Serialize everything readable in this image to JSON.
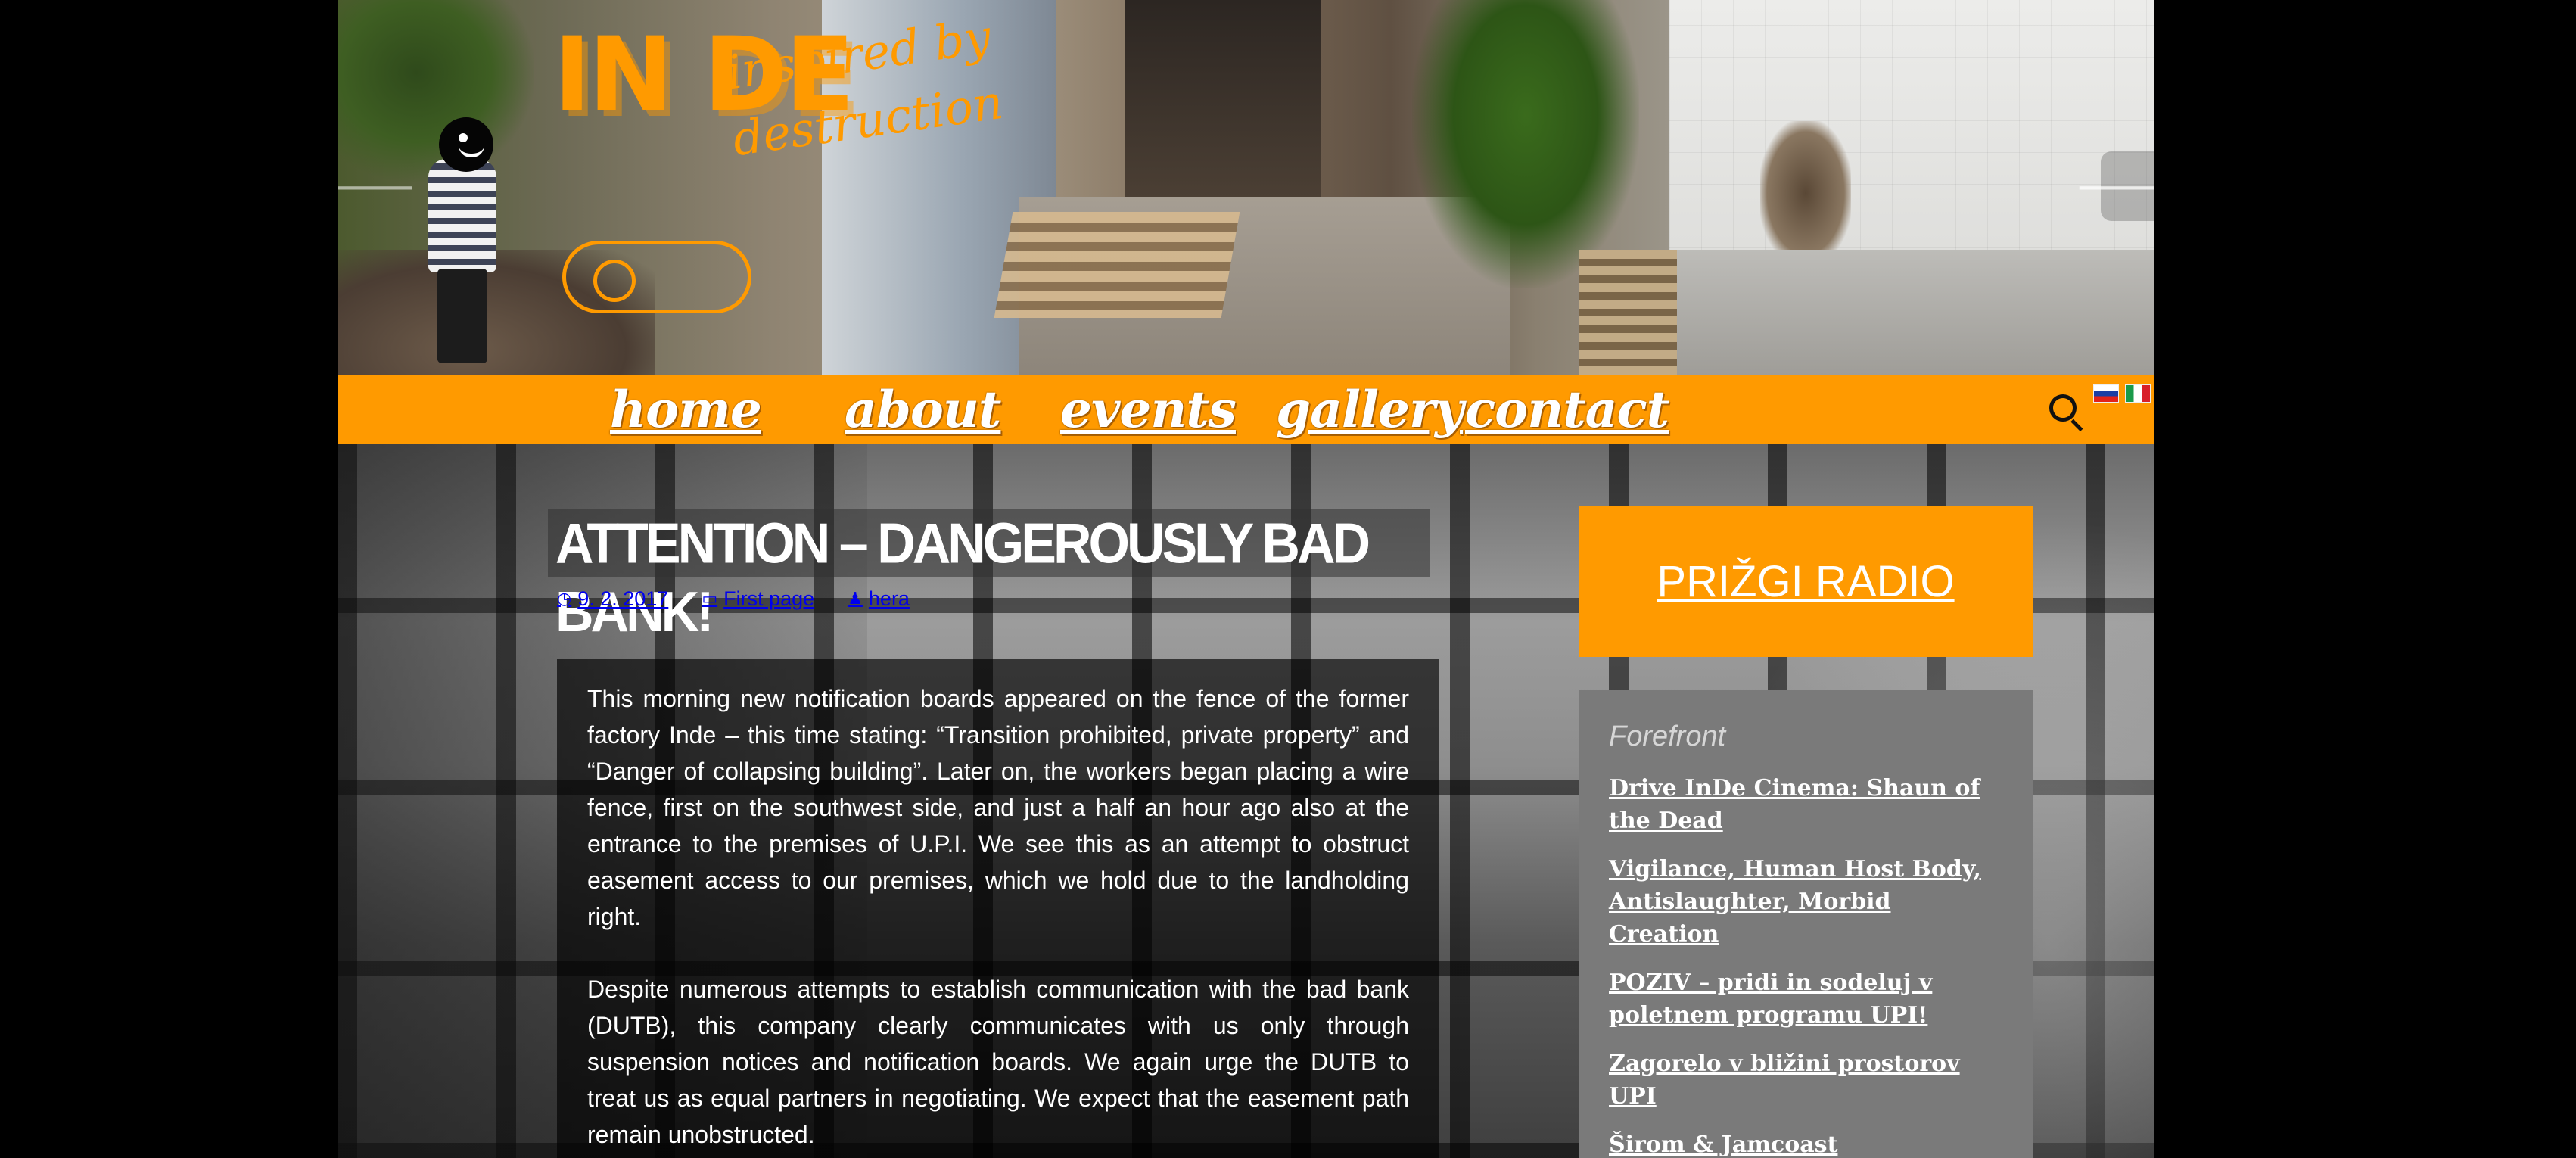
{
  "header": {
    "logo": {
      "letters": "IN DE",
      "tagline": "inspired by destruction"
    },
    "prev_arrow": "🡐",
    "next_arrow": "🡒"
  },
  "nav": {
    "items": [
      {
        "label": "home"
      },
      {
        "label": "about"
      },
      {
        "label": "events"
      },
      {
        "label": "gallery"
      },
      {
        "label": "contact"
      }
    ],
    "search_icon": "search-icon",
    "languages": [
      {
        "icon": "slovenia-flag-icon"
      },
      {
        "icon": "italy-flag-icon"
      }
    ]
  },
  "post": {
    "title": "ATTENTION – DANGEROUSLY BAD BANK!",
    "date": "9. 2. 2017",
    "category": "First page",
    "author": "hera",
    "icons": {
      "date": "clock-icon",
      "category": "folder-icon",
      "author": "user-icon"
    },
    "paragraphs": [
      "This morning new notification boards appeared on the fence of the former factory Inde – this time stating: “Transition prohibited, private property” and “Danger of collapsing building”. Later on, the workers began placing a wire fence, first on the southwest side, and just a half an hour ago also at the entrance to the premises of U.P.I. We see this as an attempt to obstruct easement access to our premises, which we hold due to the landholding right.",
      "Despite numerous attempts to establish communication with the bad bank (DUTB), this company clearly communicates with us only through suspension notices and notification boards. We again urge the DUTB to treat us as equal partners in negotiating. We expect that the easement path remain unobstructed."
    ]
  },
  "sidebar": {
    "radio_label": "PRIŽGI RADIO",
    "forefront_title": "Forefront",
    "forefront_items": [
      "Drive InDe Cinema: Shaun of the Dead",
      "Vigilance, Human Host Body, Antislaughter, Morbid Creation",
      "POZIV – pridi in sodeluj v poletnem programu UPI!",
      "Zagorelo v bližini prostorov UPI",
      "Širom & Jamcoast"
    ]
  },
  "colors": {
    "accent": "#ff9a00",
    "panel": "#7a7a7a"
  }
}
